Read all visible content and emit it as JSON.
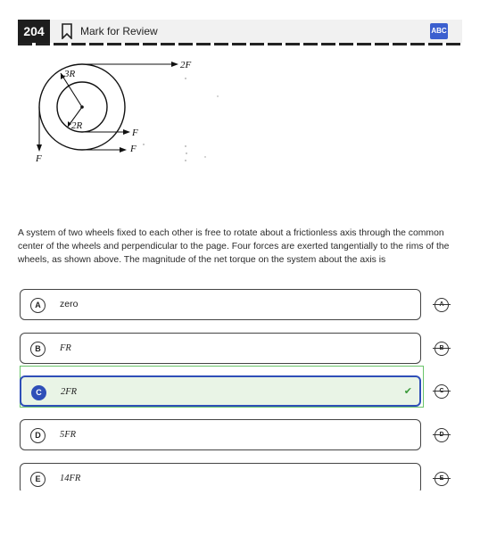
{
  "header": {
    "question_number": "204",
    "mark_for_review": "Mark for Review",
    "abc_label": "ABC"
  },
  "figure": {
    "label_outer_radius": "3R",
    "label_inner_radius": "2R",
    "label_top_force": "2F",
    "label_right_force_1": "F",
    "label_right_force_2": "F",
    "label_left_force": "F"
  },
  "question": {
    "stem": "A system of two wheels fixed to each other is free to rotate about a frictionless axis through the common center of the wheels and perpendicular to the page. Four forces are exerted tangentially to the rims of the wheels, as shown above. The magnitude of the net torque on the system about the axis is"
  },
  "choices": [
    {
      "letter": "A",
      "text": "zero"
    },
    {
      "letter": "B",
      "text": "FR"
    },
    {
      "letter": "C",
      "text": "2FR"
    },
    {
      "letter": "D",
      "text": "5FR"
    },
    {
      "letter": "E",
      "text": "14FR"
    }
  ],
  "selected_choice": "C",
  "correct_mark": "✔",
  "colors": {
    "accent": "#2f4fb8",
    "correct": "#3a9a3a",
    "selected_bg": "#e9f4e6"
  }
}
